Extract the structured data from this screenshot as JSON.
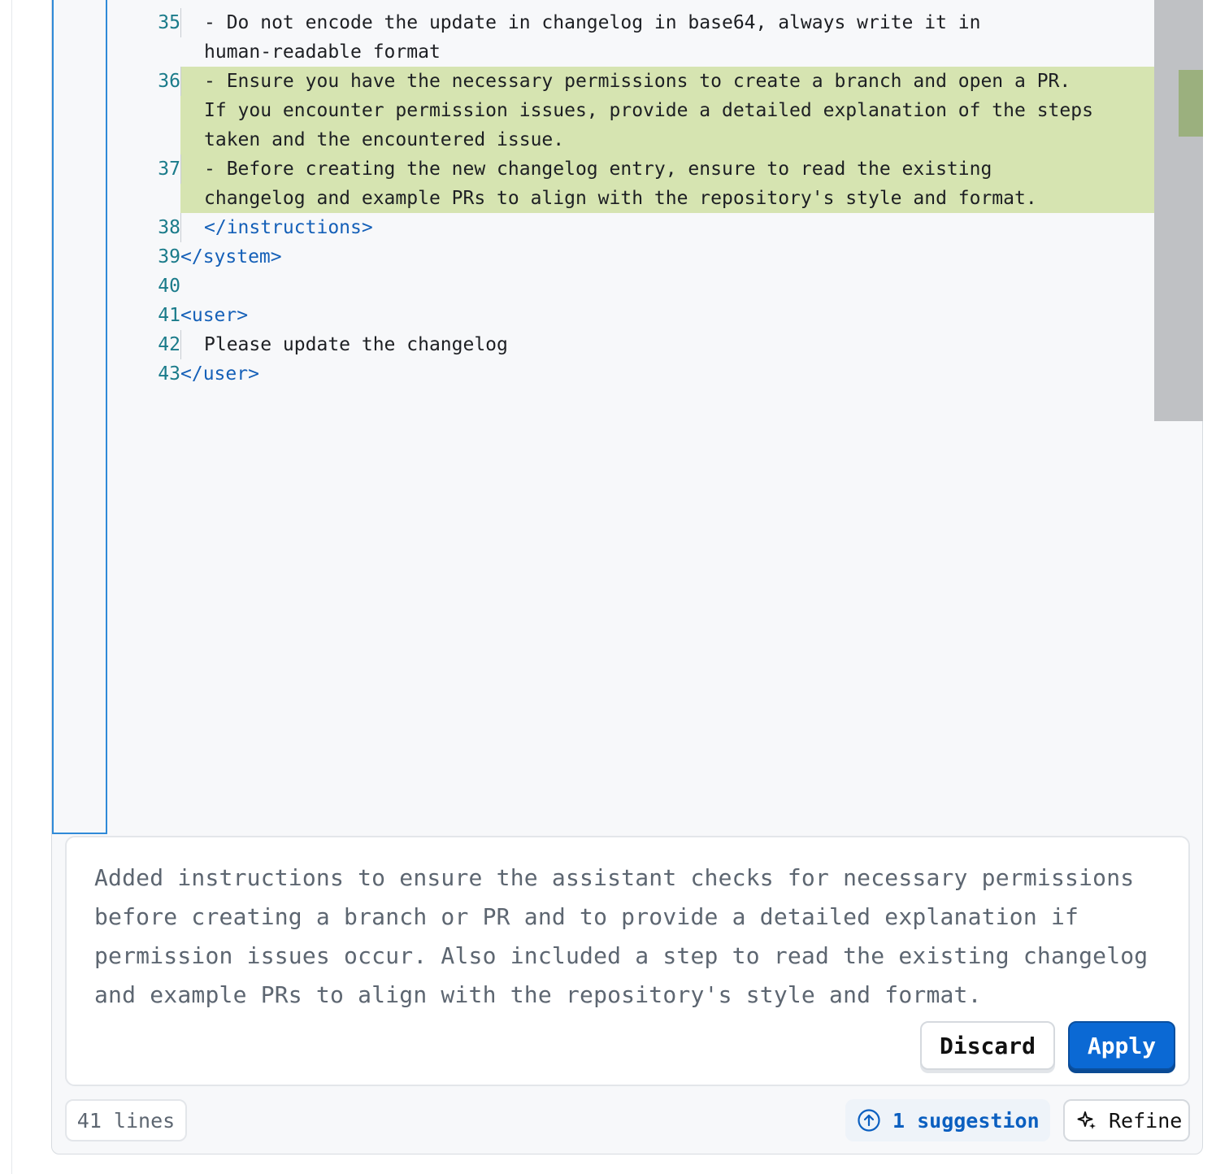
{
  "editor": {
    "lines": [
      {
        "num": "35",
        "text": "- Do not encode the update in changelog in base64, always write it in",
        "added": false,
        "tag": false,
        "guide": true
      },
      {
        "num": "",
        "text": "human-readable format",
        "added": false,
        "tag": false,
        "guide": false
      },
      {
        "num": "36",
        "text": "- Ensure you have the necessary permissions to create a branch and open a PR.",
        "added": true,
        "tag": false,
        "guide": true
      },
      {
        "num": "",
        "text": "If you encounter permission issues, provide a detailed explanation of the steps",
        "added": true,
        "tag": false,
        "guide": false
      },
      {
        "num": "",
        "text": "taken and the encountered issue.",
        "added": true,
        "tag": false,
        "guide": false
      },
      {
        "num": "37",
        "text": "- Before creating the new changelog entry, ensure to read the existing",
        "added": true,
        "tag": false,
        "guide": true
      },
      {
        "num": "",
        "text": "changelog and example PRs to align with the repository's style and format.",
        "added": true,
        "tag": false,
        "guide": false
      },
      {
        "num": "38",
        "text": "</instructions>",
        "added": false,
        "tag": true,
        "guide": true
      },
      {
        "num": "39",
        "text": "</system>",
        "added": false,
        "tag": true,
        "guide": false,
        "flush": true
      },
      {
        "num": "40",
        "text": "",
        "added": false,
        "tag": false,
        "guide": false
      },
      {
        "num": "41",
        "text": "<user>",
        "added": false,
        "tag": true,
        "guide": false,
        "flush": true
      },
      {
        "num": "42",
        "text": "Please update the changelog",
        "added": false,
        "tag": false,
        "guide": true
      },
      {
        "num": "43",
        "text": "</user>",
        "added": false,
        "tag": true,
        "guide": false,
        "flush": true
      }
    ]
  },
  "suggestion": {
    "text": "Added instructions to ensure the assistant checks for necessary permissions before creating a branch or PR and to provide a detailed explanation if permission issues occur. Also included a step to read the existing changelog and example PRs to align with the repository's style and format.",
    "discard_label": "Discard",
    "apply_label": "Apply"
  },
  "footer": {
    "line_count": "41 lines",
    "suggestion_count": "1 suggestion",
    "refine_label": "Refine"
  },
  "colors": {
    "accent": "#0b69d4",
    "added_line": "#d6e4b1",
    "tag_text": "#1560b8",
    "line_number": "#1a7b8a"
  }
}
